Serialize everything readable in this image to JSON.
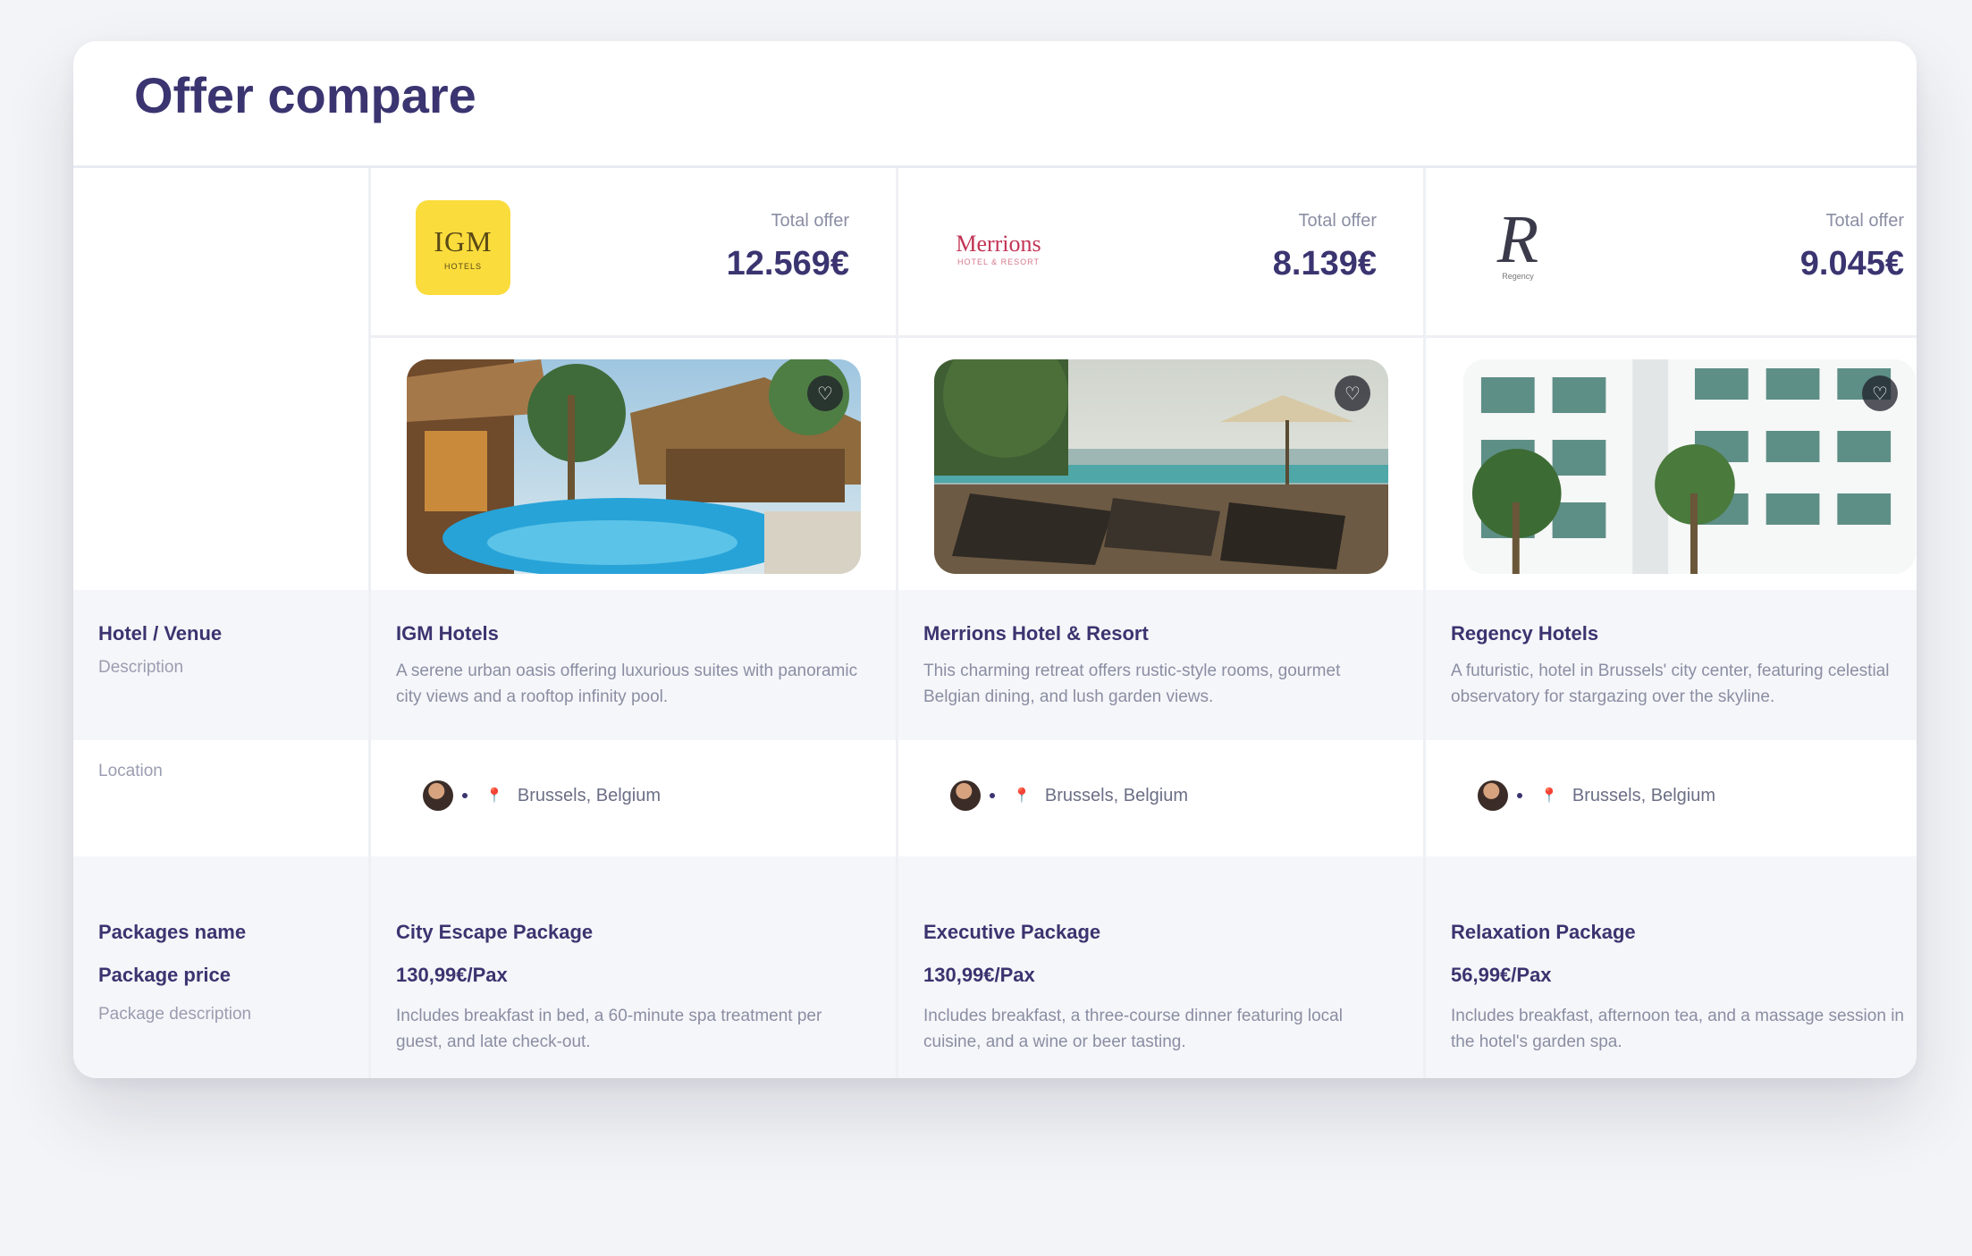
{
  "page_title": "Offer compare",
  "row_labels": {
    "hotel": "Hotel / Venue",
    "description": "Description",
    "location": "Location",
    "package_name": "Packages name",
    "package_price": "Package price",
    "package_description": "Package description"
  },
  "offers": [
    {
      "logo": {
        "mark": "IGM",
        "sub": "HOTELS"
      },
      "total_label": "Total offer",
      "total_value": "12.569€",
      "hotel_name": "IGM Hotels",
      "hotel_description": "A serene urban oasis offering luxurious suites with panoramic city views and a rooftop infinity pool.",
      "location": "Brussels, Belgium",
      "package_name": "City Escape Package",
      "package_price": "130,99€/Pax",
      "package_description": "Includes breakfast in bed, a 60-minute spa treatment per guest, and late check-out."
    },
    {
      "logo": {
        "mark": "Merrions",
        "sub": "HOTEL & RESORT"
      },
      "total_label": "Total offer",
      "total_value": "8.139€",
      "hotel_name": "Merrions Hotel & Resort",
      "hotel_description": "This charming retreat offers rustic-style rooms, gourmet Belgian dining, and lush garden views.",
      "location": "Brussels, Belgium",
      "package_name": "Executive Package",
      "package_price": "130,99€/Pax",
      "package_description": "Includes breakfast, a three-course dinner featuring local cuisine, and a wine or beer tasting."
    },
    {
      "logo": {
        "mark": "R",
        "sub": "Regency"
      },
      "total_label": "Total offer",
      "total_value": "9.045€",
      "hotel_name": "Regency Hotels",
      "hotel_description": "A futuristic, hotel in Brussels' city center, featuring celestial observatory for stargazing over the skyline.",
      "location": "Brussels, Belgium",
      "package_name": "Relaxation Package",
      "package_price": "56,99€/Pax",
      "package_description": "Includes breakfast, afternoon tea, and a massage session in the hotel's garden spa."
    }
  ],
  "icons": {
    "favorite": "heart-icon",
    "pin": "map-pin-icon"
  },
  "colors": {
    "title": "#3a3470",
    "igm_logo_bg": "#fadc3c",
    "merrions_logo": "#c23455",
    "row_shade": "#f5f6f9"
  }
}
